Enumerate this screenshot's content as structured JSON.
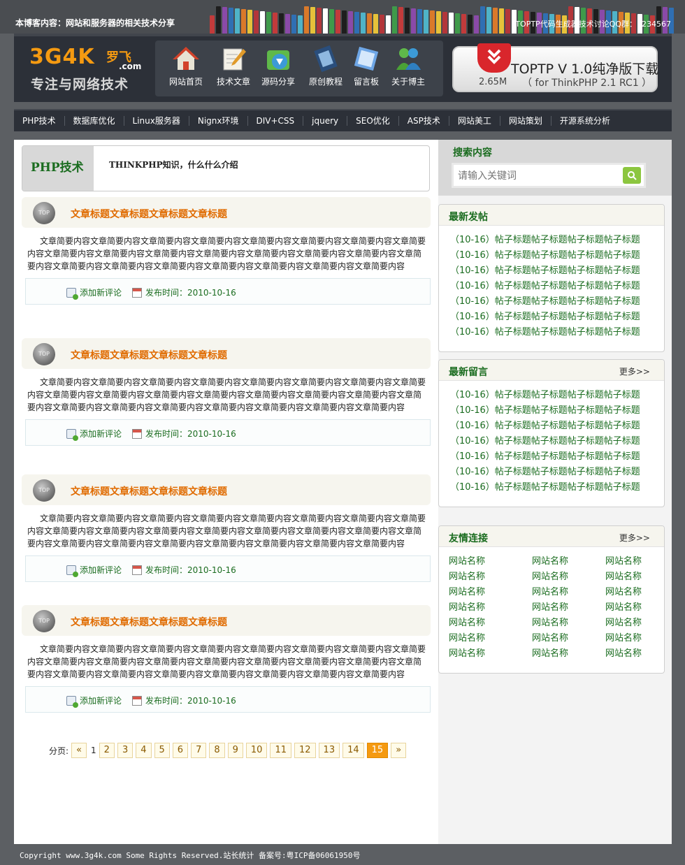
{
  "top": {
    "tagline": "本博客内容：网站和服务器的相关技术分享",
    "qq": "TOPTP代码生成器技术讨论QQ群：1234567"
  },
  "logo": {
    "main": "3G4K",
    "cn": "罗飞",
    "com": ".com",
    "slogan": "专注与网络技术"
  },
  "nav": [
    {
      "label": "网站首页",
      "icon": "home-icon"
    },
    {
      "label": "技术文章",
      "icon": "document-pen-icon"
    },
    {
      "label": "源码分享",
      "icon": "download-icon"
    },
    {
      "label": "原创教程",
      "icon": "film-icon"
    },
    {
      "label": "留言板",
      "icon": "note-icon"
    },
    {
      "label": "关于博主",
      "icon": "users-icon"
    }
  ],
  "download": {
    "title": "TOPTP V 1.0纯净版下载",
    "subtitle": "（ for ThinkPHP 2.1 RC1 ）",
    "size": "2.65M",
    "badge_color": "#d9262c"
  },
  "menu": [
    "PHP技术",
    "数据库优化",
    "Linux服务器",
    "Nignx环境",
    "DIV+CSS",
    "jquery",
    "SEO优化",
    "ASP技术",
    "网站美工",
    "网站策划",
    "开源系统分析"
  ],
  "section": {
    "title": "PHP技术",
    "desc": "THINKPHP知识，什么什么介绍"
  },
  "posts": [
    {
      "badge": "TOP",
      "title": "文章标题文章标题文章标题文章标题",
      "body": "文章简要内容文章简要内容文章简要内容文章简要内容文章简要内容文章简要内容文章简要内容文章简要内容文章简要内容文章简要内容文章简要内容文章简要内容文章简要内容文章简要内容文章简要内容文章简要内容文章简要内容文章简要内容文章简要内容文章简要内容文章简要内容文章简要内容文章简要内容",
      "comment": "添加新评论",
      "date": "发布时间：2010-10-16"
    },
    {
      "badge": "TOP",
      "title": "文章标题文章标题文章标题文章标题",
      "body": "文章简要内容文章简要内容文章简要内容文章简要内容文章简要内容文章简要内容文章简要内容文章简要内容文章简要内容文章简要内容文章简要内容文章简要内容文章简要内容文章简要内容文章简要内容文章简要内容文章简要内容文章简要内容文章简要内容文章简要内容文章简要内容文章简要内容文章简要内容",
      "comment": "添加新评论",
      "date": "发布时间：2010-10-16"
    },
    {
      "badge": "TOP",
      "title": "文章标题文章标题文章标题文章标题",
      "body": "文章简要内容文章简要内容文章简要内容文章简要内容文章简要内容文章简要内容文章简要内容文章简要内容文章简要内容文章简要内容文章简要内容文章简要内容文章简要内容文章简要内容文章简要内容文章简要内容文章简要内容文章简要内容文章简要内容文章简要内容文章简要内容文章简要内容文章简要内容",
      "comment": "添加新评论",
      "date": "发布时间：2010-10-16"
    },
    {
      "badge": "TOP",
      "title": "文章标题文章标题文章标题文章标题",
      "body": "文章简要内容文章简要内容文章简要内容文章简要内容文章简要内容文章简要内容文章简要内容文章简要内容文章简要内容文章简要内容文章简要内容文章简要内容文章简要内容文章简要内容文章简要内容文章简要内容文章简要内容文章简要内容文章简要内容文章简要内容文章简要内容文章简要内容文章简要内容",
      "comment": "添加新评论",
      "date": "发布时间：2010-10-16"
    }
  ],
  "pager": {
    "label": "分页:",
    "prev": "«",
    "first": "1",
    "pages": [
      "2",
      "3",
      "4",
      "5",
      "6",
      "7",
      "8",
      "9",
      "10",
      "11",
      "12",
      "13",
      "14"
    ],
    "current": "15",
    "next": "»"
  },
  "search": {
    "title": "搜索内容",
    "placeholder": "请输入关键词"
  },
  "latest_posts": {
    "title": "最新发帖",
    "items": [
      "（10-16）帖子标题帖子标题帖子标题帖子标题",
      "（10-16）帖子标题帖子标题帖子标题帖子标题",
      "（10-16）帖子标题帖子标题帖子标题帖子标题",
      "（10-16）帖子标题帖子标题帖子标题帖子标题",
      "（10-16）帖子标题帖子标题帖子标题帖子标题",
      "（10-16）帖子标题帖子标题帖子标题帖子标题",
      "（10-16）帖子标题帖子标题帖子标题帖子标题"
    ]
  },
  "latest_messages": {
    "title": "最新留言",
    "more": "更多>>",
    "items": [
      "（10-16）帖子标题帖子标题帖子标题帖子标题",
      "（10-16）帖子标题帖子标题帖子标题帖子标题",
      "（10-16）帖子标题帖子标题帖子标题帖子标题",
      "（10-16）帖子标题帖子标题帖子标题帖子标题",
      "（10-16）帖子标题帖子标题帖子标题帖子标题",
      "（10-16）帖子标题帖子标题帖子标题帖子标题",
      "（10-16）帖子标题帖子标题帖子标题帖子标题"
    ]
  },
  "friend_links": {
    "title": "友情连接",
    "more": "更多>>",
    "items": [
      "网站名称",
      "网站名称",
      "网站名称",
      "网站名称",
      "网站名称",
      "网站名称",
      "网站名称",
      "网站名称",
      "网站名称",
      "网站名称",
      "网站名称",
      "网站名称",
      "网站名称",
      "网站名称",
      "网站名称",
      "网站名称",
      "网站名称",
      "网站名称",
      "网站名称",
      "网站名称",
      "网站名称"
    ]
  },
  "footer": {
    "text": "Copyright www.3g4k.com Some Rights Reserved.站长统计 备案号:粤ICP备06061950号"
  },
  "colors": {
    "accent_orange": "#f59a11",
    "link_green": "#1a6c1f",
    "title_orange": "#e06b00",
    "header_dark": "#2c3038"
  }
}
